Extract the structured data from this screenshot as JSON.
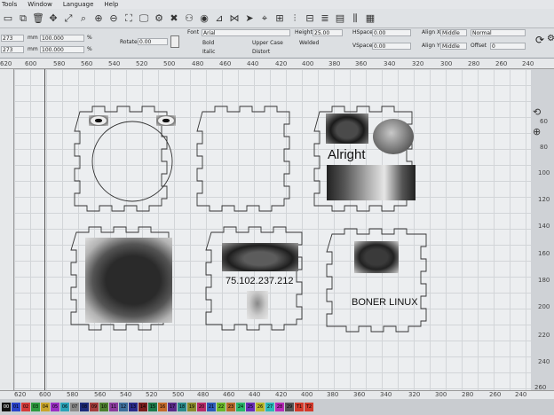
{
  "menu": [
    "Tools",
    "Window",
    "Language",
    "Help"
  ],
  "toolbar_icons": [
    "save-icon",
    "copy-icon",
    "delete-icon",
    "move-icon",
    "scale-icon",
    "zoom-icon",
    "zoom-in-icon",
    "zoom-out-icon",
    "frame-icon",
    "monitor-icon",
    "settings-icon",
    "tools-icon",
    "users-icon",
    "camera-icon",
    "align-icon",
    "mirror-icon",
    "send-icon",
    "target-icon",
    "grid-icon",
    "equalizer-icon",
    "lock-icon",
    "layers-icon",
    "document-icon",
    "distribute-icon",
    "select-icon"
  ],
  "props": {
    "x": "273",
    "y": "273",
    "unit1": "mm",
    "unit2": "mm",
    "w": "100.000",
    "h": "100.000",
    "pct1": "%",
    "pct2": "%",
    "rotate_label": "Rotate",
    "rotate_value": "0.00",
    "font_label": "Font",
    "font_value": "Arial",
    "height_label": "Height",
    "height_value": "25.00",
    "hspace_label": "HSpace",
    "hspace_value": "0.00",
    "vspace_label": "VSpace",
    "vspace_value": "0.00",
    "bold": "Bold",
    "italic": "Italic",
    "upper": "Upper Case",
    "distort": "Distort",
    "welded": "Welded",
    "alignx_label": "Align X",
    "alignx_value": "Middle",
    "aligny_label": "Align Y",
    "aligny_value": "Middle",
    "mode_value": "Normal",
    "offset_label": "Offset",
    "offset_value": "0"
  },
  "ruler_top": [
    "620",
    "600",
    "580",
    "560",
    "540",
    "520",
    "500",
    "480",
    "460",
    "440",
    "420",
    "400",
    "380",
    "360",
    "340",
    "320",
    "300",
    "280",
    "260",
    "240"
  ],
  "ruler_bottom": [
    "620",
    "600",
    "580",
    "560",
    "540",
    "520",
    "500",
    "480",
    "460",
    "440",
    "420",
    "400",
    "380",
    "360",
    "340",
    "320",
    "300",
    "280",
    "260",
    "240"
  ],
  "ruler_right": [
    "60",
    "80",
    "100",
    "120",
    "140",
    "160",
    "180",
    "200",
    "220",
    "240",
    "260"
  ],
  "canvas_text": {
    "alright": "Alright",
    "ip": "75.102.237.212",
    "boner": "BONER LINUX"
  },
  "palette": [
    "00",
    "01",
    "02",
    "03",
    "04",
    "05",
    "06",
    "07",
    "08",
    "09",
    "10",
    "11",
    "12",
    "13",
    "14",
    "15",
    "16",
    "17",
    "18",
    "19",
    "20",
    "21",
    "22",
    "23",
    "24",
    "25",
    "26",
    "27",
    "28",
    "29",
    "T1",
    "T2"
  ],
  "palette_colors": [
    "#111111",
    "#2b43c9",
    "#d43b3b",
    "#2e9b3f",
    "#c9a52b",
    "#9b2fc4",
    "#2ba3b8",
    "#8a8a8a",
    "#1d2b7a",
    "#a33d3d",
    "#4d7f2e",
    "#8a3b9c",
    "#3d6e9b",
    "#2b2b8a",
    "#7a1d1d",
    "#1d7a4a",
    "#c46a2b",
    "#5a2b8a",
    "#2b8a8a",
    "#8a8a2b",
    "#b82b6a",
    "#2b5ab8",
    "#6ab82b",
    "#b86a2b",
    "#2bb86a",
    "#6a2bb8",
    "#b8b82b",
    "#2bb8b8",
    "#b82bb8",
    "#555555",
    "#d33a2b",
    "#d33a2b"
  ]
}
